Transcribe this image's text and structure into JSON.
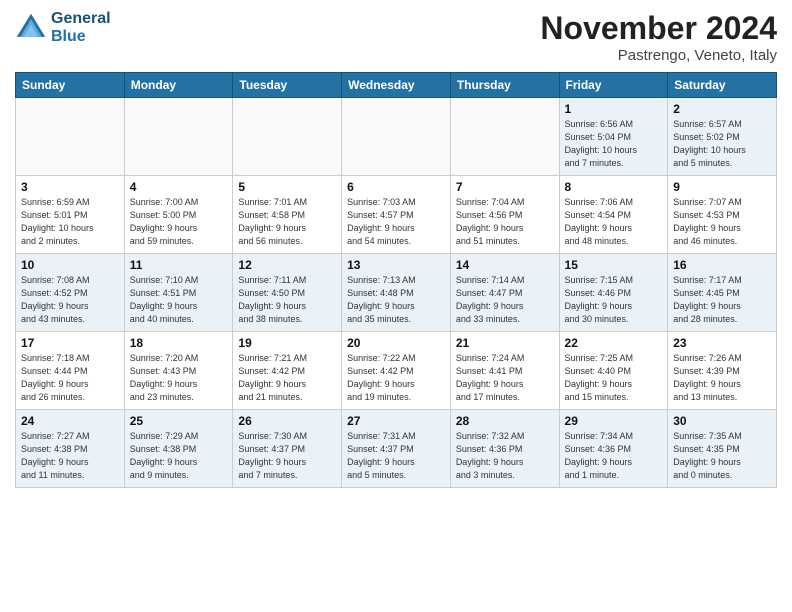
{
  "header": {
    "logo_line1": "General",
    "logo_line2": "Blue",
    "month": "November 2024",
    "location": "Pastrengo, Veneto, Italy"
  },
  "weekdays": [
    "Sunday",
    "Monday",
    "Tuesday",
    "Wednesday",
    "Thursday",
    "Friday",
    "Saturday"
  ],
  "weeks": [
    [
      {
        "day": "",
        "info": ""
      },
      {
        "day": "",
        "info": ""
      },
      {
        "day": "",
        "info": ""
      },
      {
        "day": "",
        "info": ""
      },
      {
        "day": "",
        "info": ""
      },
      {
        "day": "1",
        "info": "Sunrise: 6:56 AM\nSunset: 5:04 PM\nDaylight: 10 hours\nand 7 minutes."
      },
      {
        "day": "2",
        "info": "Sunrise: 6:57 AM\nSunset: 5:02 PM\nDaylight: 10 hours\nand 5 minutes."
      }
    ],
    [
      {
        "day": "3",
        "info": "Sunrise: 6:59 AM\nSunset: 5:01 PM\nDaylight: 10 hours\nand 2 minutes."
      },
      {
        "day": "4",
        "info": "Sunrise: 7:00 AM\nSunset: 5:00 PM\nDaylight: 9 hours\nand 59 minutes."
      },
      {
        "day": "5",
        "info": "Sunrise: 7:01 AM\nSunset: 4:58 PM\nDaylight: 9 hours\nand 56 minutes."
      },
      {
        "day": "6",
        "info": "Sunrise: 7:03 AM\nSunset: 4:57 PM\nDaylight: 9 hours\nand 54 minutes."
      },
      {
        "day": "7",
        "info": "Sunrise: 7:04 AM\nSunset: 4:56 PM\nDaylight: 9 hours\nand 51 minutes."
      },
      {
        "day": "8",
        "info": "Sunrise: 7:06 AM\nSunset: 4:54 PM\nDaylight: 9 hours\nand 48 minutes."
      },
      {
        "day": "9",
        "info": "Sunrise: 7:07 AM\nSunset: 4:53 PM\nDaylight: 9 hours\nand 46 minutes."
      }
    ],
    [
      {
        "day": "10",
        "info": "Sunrise: 7:08 AM\nSunset: 4:52 PM\nDaylight: 9 hours\nand 43 minutes."
      },
      {
        "day": "11",
        "info": "Sunrise: 7:10 AM\nSunset: 4:51 PM\nDaylight: 9 hours\nand 40 minutes."
      },
      {
        "day": "12",
        "info": "Sunrise: 7:11 AM\nSunset: 4:50 PM\nDaylight: 9 hours\nand 38 minutes."
      },
      {
        "day": "13",
        "info": "Sunrise: 7:13 AM\nSunset: 4:48 PM\nDaylight: 9 hours\nand 35 minutes."
      },
      {
        "day": "14",
        "info": "Sunrise: 7:14 AM\nSunset: 4:47 PM\nDaylight: 9 hours\nand 33 minutes."
      },
      {
        "day": "15",
        "info": "Sunrise: 7:15 AM\nSunset: 4:46 PM\nDaylight: 9 hours\nand 30 minutes."
      },
      {
        "day": "16",
        "info": "Sunrise: 7:17 AM\nSunset: 4:45 PM\nDaylight: 9 hours\nand 28 minutes."
      }
    ],
    [
      {
        "day": "17",
        "info": "Sunrise: 7:18 AM\nSunset: 4:44 PM\nDaylight: 9 hours\nand 26 minutes."
      },
      {
        "day": "18",
        "info": "Sunrise: 7:20 AM\nSunset: 4:43 PM\nDaylight: 9 hours\nand 23 minutes."
      },
      {
        "day": "19",
        "info": "Sunrise: 7:21 AM\nSunset: 4:42 PM\nDaylight: 9 hours\nand 21 minutes."
      },
      {
        "day": "20",
        "info": "Sunrise: 7:22 AM\nSunset: 4:42 PM\nDaylight: 9 hours\nand 19 minutes."
      },
      {
        "day": "21",
        "info": "Sunrise: 7:24 AM\nSunset: 4:41 PM\nDaylight: 9 hours\nand 17 minutes."
      },
      {
        "day": "22",
        "info": "Sunrise: 7:25 AM\nSunset: 4:40 PM\nDaylight: 9 hours\nand 15 minutes."
      },
      {
        "day": "23",
        "info": "Sunrise: 7:26 AM\nSunset: 4:39 PM\nDaylight: 9 hours\nand 13 minutes."
      }
    ],
    [
      {
        "day": "24",
        "info": "Sunrise: 7:27 AM\nSunset: 4:38 PM\nDaylight: 9 hours\nand 11 minutes."
      },
      {
        "day": "25",
        "info": "Sunrise: 7:29 AM\nSunset: 4:38 PM\nDaylight: 9 hours\nand 9 minutes."
      },
      {
        "day": "26",
        "info": "Sunrise: 7:30 AM\nSunset: 4:37 PM\nDaylight: 9 hours\nand 7 minutes."
      },
      {
        "day": "27",
        "info": "Sunrise: 7:31 AM\nSunset: 4:37 PM\nDaylight: 9 hours\nand 5 minutes."
      },
      {
        "day": "28",
        "info": "Sunrise: 7:32 AM\nSunset: 4:36 PM\nDaylight: 9 hours\nand 3 minutes."
      },
      {
        "day": "29",
        "info": "Sunrise: 7:34 AM\nSunset: 4:36 PM\nDaylight: 9 hours\nand 1 minute."
      },
      {
        "day": "30",
        "info": "Sunrise: 7:35 AM\nSunset: 4:35 PM\nDaylight: 9 hours\nand 0 minutes."
      }
    ]
  ]
}
